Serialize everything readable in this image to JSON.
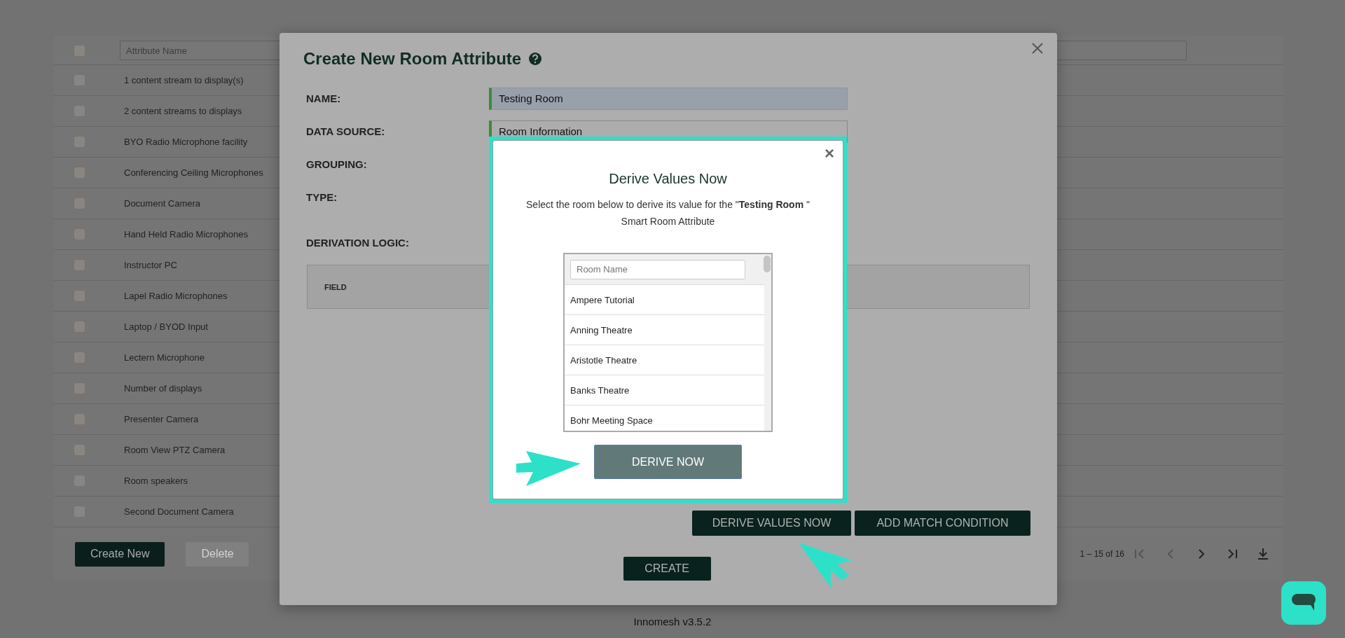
{
  "table": {
    "header": {
      "checked": false,
      "filter": {
        "placeholder": "Attribute Name"
      }
    },
    "rows": [
      {
        "name": "1 content stream to display(s)",
        "checked": false
      },
      {
        "name": "2 content streams to displays",
        "checked": false
      },
      {
        "name": "BYO Radio Microphone facility",
        "checked": false
      },
      {
        "name": "Conferencing Ceiling Microphones",
        "checked": false
      },
      {
        "name": "Document Camera",
        "checked": false
      },
      {
        "name": "Hand Held Radio Microphones",
        "checked": false
      },
      {
        "name": "Instructor PC",
        "checked": false
      },
      {
        "name": "Lapel Radio Microphones",
        "checked": false
      },
      {
        "name": "Laptop / BYOD Input",
        "checked": false
      },
      {
        "name": "Lectern Microphone",
        "checked": false
      },
      {
        "name": "Number of displays",
        "checked": false
      },
      {
        "name": "Presenter Camera",
        "checked": false
      },
      {
        "name": "Room View PTZ Camera",
        "checked": false
      },
      {
        "name": "Room speakers",
        "checked": false
      },
      {
        "name": "Second Document Camera",
        "checked": false
      }
    ],
    "buttons": [
      {
        "label": "Create New",
        "disabled": false
      },
      {
        "label": "Delete",
        "disabled": true
      }
    ],
    "pagination": {
      "range": "1 – 15 of 16",
      "controls": [
        {
          "kind": "first",
          "disabled": true
        },
        {
          "kind": "prev",
          "disabled": true
        },
        {
          "kind": "next",
          "disabled": false
        },
        {
          "kind": "last",
          "disabled": false
        },
        {
          "kind": "download",
          "disabled": false
        }
      ]
    }
  },
  "footer": "Innomesh v3.5.2",
  "modal": {
    "title": "Create New Room Attribute",
    "fields": [
      {
        "label": "NAME:",
        "value": "Testing Room"
      },
      {
        "label": "DATA SOURCE:",
        "value": "Room Information"
      },
      {
        "label": "GROUPING:"
      },
      {
        "label": "TYPE:"
      }
    ],
    "derivation_label": "DERIVATION LOGIC:",
    "table_column": "FIELD",
    "buttons": [
      "DERIVE VALUES NOW",
      "ADD MATCH CONDITION"
    ],
    "create": "CREATE"
  },
  "dialog": {
    "close": "×",
    "title": "Derive Values Now",
    "text": "Select the room below to derive its value for the \"**Testing Room** \" Smart Room Attribute",
    "search": {
      "placeholder": "Room Name"
    },
    "rooms": [
      "Ampere Tutorial",
      "Anning Theatre",
      "Aristotle Theatre",
      "Banks Theatre",
      "Bohr Meeting Space"
    ],
    "button": "DERIVE NOW"
  }
}
